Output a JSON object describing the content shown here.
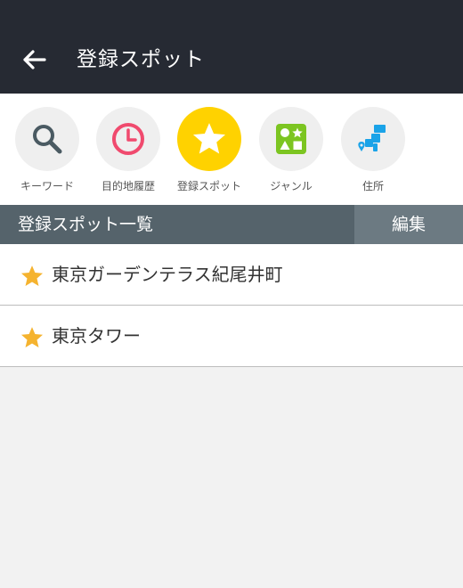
{
  "header": {
    "title": "登録スポット",
    "back_icon": "arrow-left-icon",
    "background": "#262a33"
  },
  "categories": [
    {
      "label": "キーワード",
      "icon": "search-icon",
      "active": false
    },
    {
      "label": "目的地履歴",
      "icon": "clock-icon",
      "active": false
    },
    {
      "label": "登録スポット",
      "icon": "star-icon",
      "active": true
    },
    {
      "label": "ジャンル",
      "icon": "genre-shapes-icon",
      "active": false
    },
    {
      "label": "住所",
      "icon": "address-pin-icon",
      "active": false
    }
  ],
  "section": {
    "title": "登録スポット一覧",
    "edit_label": "編集"
  },
  "spots": [
    {
      "name": "東京ガーデンテラス紀尾井町",
      "icon": "star-icon"
    },
    {
      "name": "東京タワー",
      "icon": "star-icon"
    }
  ],
  "colors": {
    "accent": "#ffd200",
    "star": "#f5b32f",
    "section_bar": "#55636b",
    "edit_button": "#6c7a82",
    "clock": "#f04a6e",
    "genre": "#7cc521",
    "address": "#1aa3e8"
  }
}
